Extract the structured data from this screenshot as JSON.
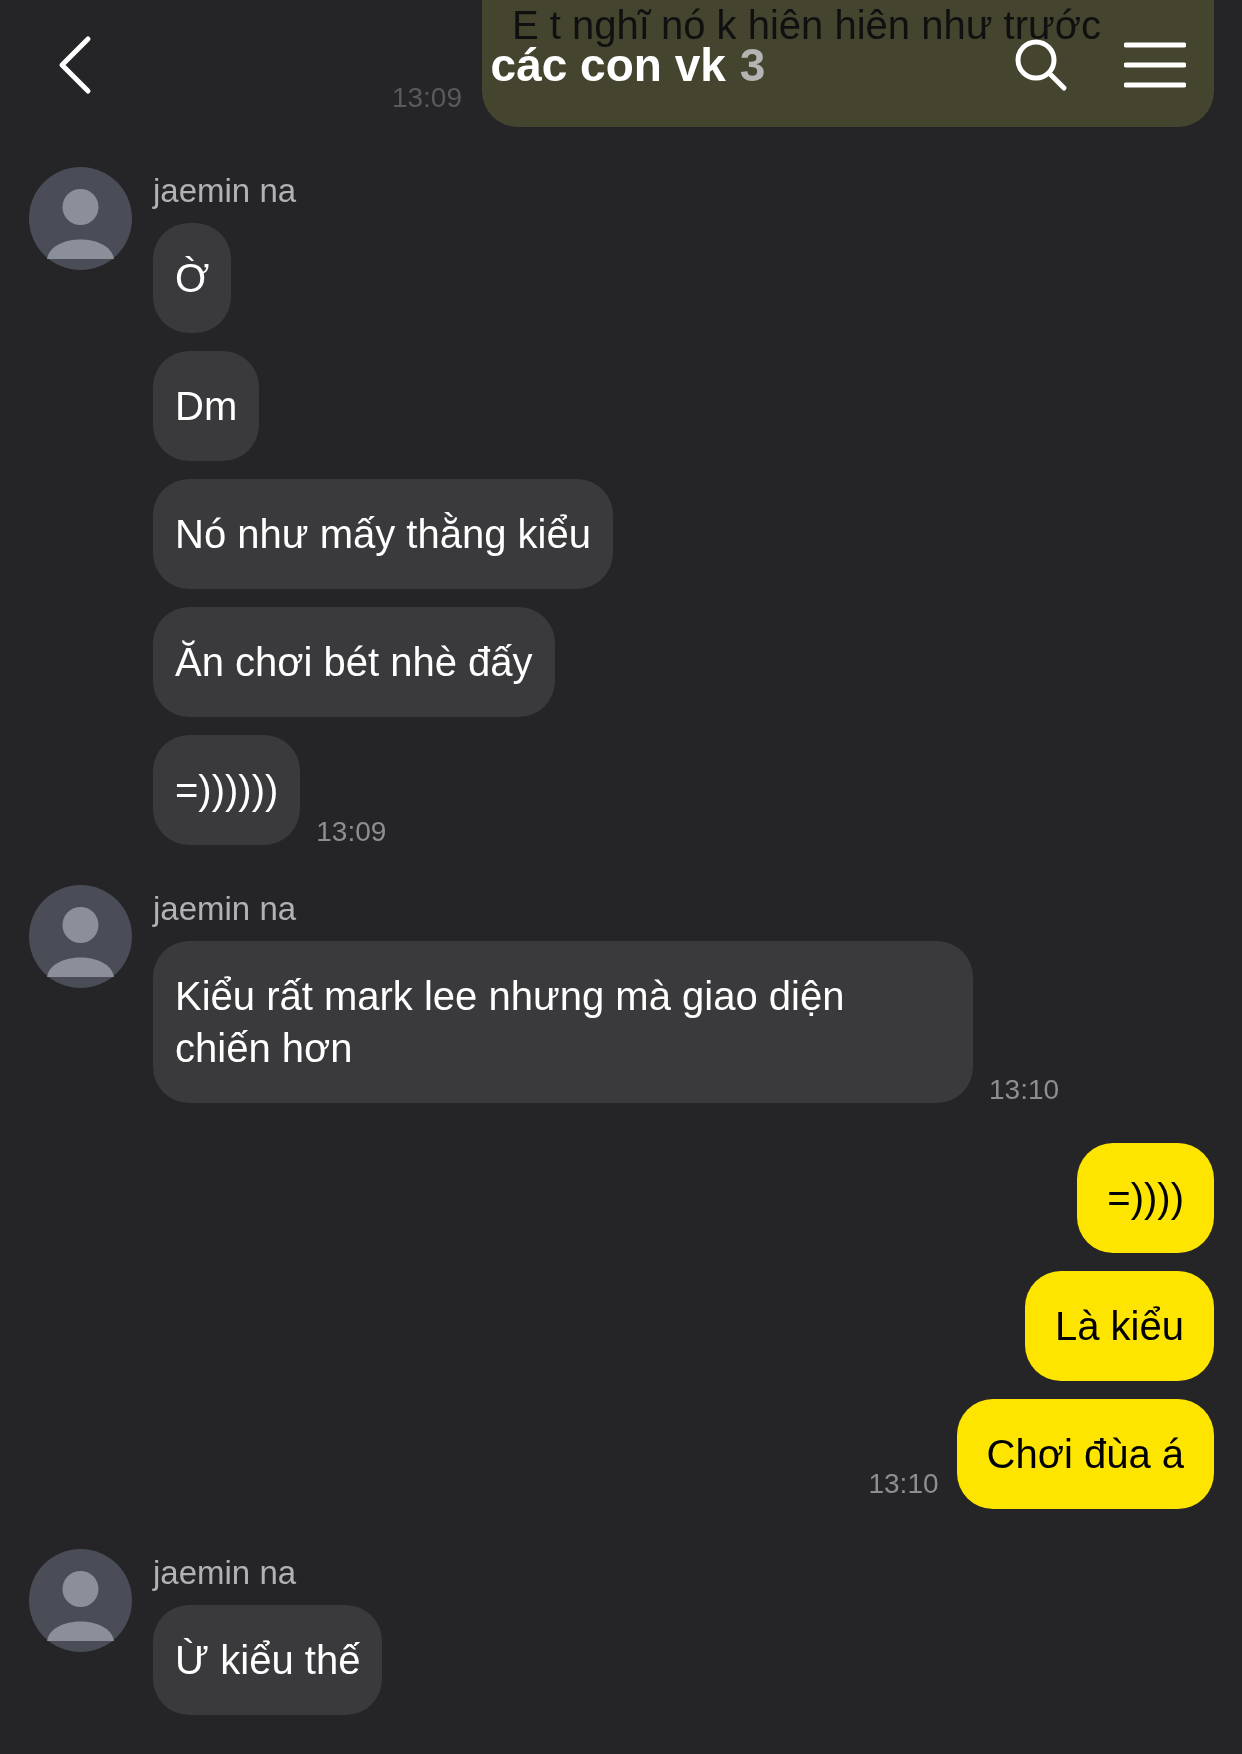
{
  "header": {
    "title": "các con vk",
    "member_count": "3"
  },
  "partial_message": {
    "text": "E t nghĩ nó k hiên hiên như trước",
    "time": "13:09"
  },
  "groups": [
    {
      "kind": "received",
      "sender": "jaemin na",
      "messages": [
        "Ờ",
        "Dm",
        "Nó như mấy thằng kiểu",
        "Ăn chơi bét nhè đấy",
        "=))))))"
      ],
      "time": "13:09"
    },
    {
      "kind": "received",
      "sender": "jaemin na",
      "messages": [
        "Kiểu rất mark lee nhưng mà giao diện chiến hơn"
      ],
      "time": "13:10"
    },
    {
      "kind": "sent",
      "messages": [
        "=))))",
        "Là kiểu",
        "Chơi đùa á"
      ],
      "time": "13:10"
    },
    {
      "kind": "received",
      "sender": "jaemin na",
      "messages": [
        "Ừ kiểu thế"
      ]
    }
  ]
}
